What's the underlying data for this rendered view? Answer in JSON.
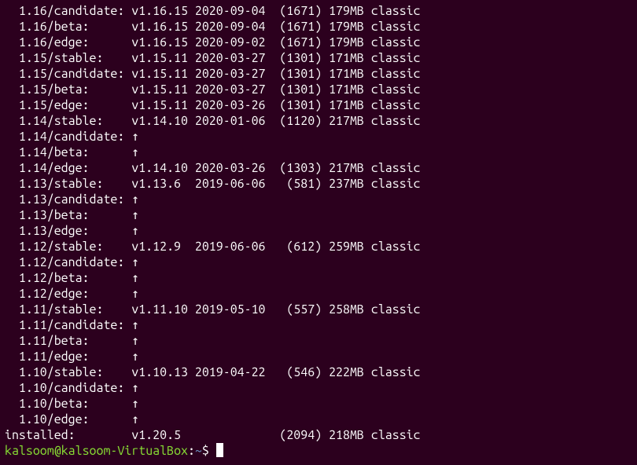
{
  "rows": [
    {
      "channel": "  1.16/candidate:",
      "version": "v1.16.15",
      "date": "2020-09-04",
      "rev": "(1671)",
      "size": "179MB",
      "notes": "classic"
    },
    {
      "channel": "  1.16/beta:",
      "version": "v1.16.15",
      "date": "2020-09-04",
      "rev": "(1671)",
      "size": "179MB",
      "notes": "classic"
    },
    {
      "channel": "  1.16/edge:",
      "version": "v1.16.15",
      "date": "2020-09-02",
      "rev": "(1671)",
      "size": "179MB",
      "notes": "classic"
    },
    {
      "channel": "  1.15/stable:",
      "version": "v1.15.11",
      "date": "2020-03-27",
      "rev": "(1301)",
      "size": "171MB",
      "notes": "classic"
    },
    {
      "channel": "  1.15/candidate:",
      "version": "v1.15.11",
      "date": "2020-03-27",
      "rev": "(1301)",
      "size": "171MB",
      "notes": "classic"
    },
    {
      "channel": "  1.15/beta:",
      "version": "v1.15.11",
      "date": "2020-03-27",
      "rev": "(1301)",
      "size": "171MB",
      "notes": "classic"
    },
    {
      "channel": "  1.15/edge:",
      "version": "v1.15.11",
      "date": "2020-03-26",
      "rev": "(1301)",
      "size": "171MB",
      "notes": "classic"
    },
    {
      "channel": "  1.14/stable:",
      "version": "v1.14.10",
      "date": "2020-01-06",
      "rev": "(1120)",
      "size": "217MB",
      "notes": "classic"
    },
    {
      "channel": "  1.14/candidate:",
      "arrow": "↑"
    },
    {
      "channel": "  1.14/beta:",
      "arrow": "↑"
    },
    {
      "channel": "  1.14/edge:",
      "version": "v1.14.10",
      "date": "2020-03-26",
      "rev": "(1303)",
      "size": "217MB",
      "notes": "classic"
    },
    {
      "channel": "  1.13/stable:",
      "version": "v1.13.6",
      "date": "2019-06-06",
      "rev": "(581)",
      "size": "237MB",
      "notes": "classic"
    },
    {
      "channel": "  1.13/candidate:",
      "arrow": "↑"
    },
    {
      "channel": "  1.13/beta:",
      "arrow": "↑"
    },
    {
      "channel": "  1.13/edge:",
      "arrow": "↑"
    },
    {
      "channel": "  1.12/stable:",
      "version": "v1.12.9",
      "date": "2019-06-06",
      "rev": "(612)",
      "size": "259MB",
      "notes": "classic"
    },
    {
      "channel": "  1.12/candidate:",
      "arrow": "↑"
    },
    {
      "channel": "  1.12/beta:",
      "arrow": "↑"
    },
    {
      "channel": "  1.12/edge:",
      "arrow": "↑"
    },
    {
      "channel": "  1.11/stable:",
      "version": "v1.11.10",
      "date": "2019-05-10",
      "rev": "(557)",
      "size": "258MB",
      "notes": "classic"
    },
    {
      "channel": "  1.11/candidate:",
      "arrow": "↑"
    },
    {
      "channel": "  1.11/beta:",
      "arrow": "↑"
    },
    {
      "channel": "  1.11/edge:",
      "arrow": "↑"
    },
    {
      "channel": "  1.10/stable:",
      "version": "v1.10.13",
      "date": "2019-04-22",
      "rev": "(546)",
      "size": "222MB",
      "notes": "classic"
    },
    {
      "channel": "  1.10/candidate:",
      "arrow": "↑"
    },
    {
      "channel": "  1.10/beta:",
      "arrow": "↑"
    },
    {
      "channel": "  1.10/edge:",
      "arrow": "↑"
    },
    {
      "channel": "installed:",
      "version": "v1.20.5",
      "date": "",
      "rev": "(2094)",
      "size": "218MB",
      "notes": "classic"
    }
  ],
  "prompt": {
    "user": "kalsoom",
    "at": "@",
    "host": "kalsoom-VirtualBox",
    "colon": ":",
    "path": "~",
    "dollar": "$ "
  }
}
